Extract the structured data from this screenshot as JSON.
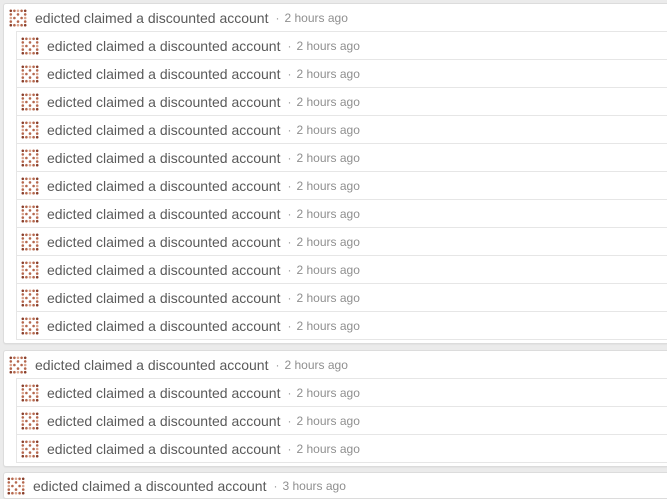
{
  "feed": {
    "separator": "·",
    "groups": [
      {
        "header": {
          "text": "edicted claimed a discounted account",
          "time": "2 hours ago"
        },
        "children": [
          {
            "text": "edicted claimed a discounted account",
            "time": "2 hours ago"
          },
          {
            "text": "edicted claimed a discounted account",
            "time": "2 hours ago"
          },
          {
            "text": "edicted claimed a discounted account",
            "time": "2 hours ago"
          },
          {
            "text": "edicted claimed a discounted account",
            "time": "2 hours ago"
          },
          {
            "text": "edicted claimed a discounted account",
            "time": "2 hours ago"
          },
          {
            "text": "edicted claimed a discounted account",
            "time": "2 hours ago"
          },
          {
            "text": "edicted claimed a discounted account",
            "time": "2 hours ago"
          },
          {
            "text": "edicted claimed a discounted account",
            "time": "2 hours ago"
          },
          {
            "text": "edicted claimed a discounted account",
            "time": "2 hours ago"
          },
          {
            "text": "edicted claimed a discounted account",
            "time": "2 hours ago"
          },
          {
            "text": "edicted claimed a discounted account",
            "time": "2 hours ago"
          }
        ]
      },
      {
        "header": {
          "text": "edicted claimed a discounted account",
          "time": "2 hours ago"
        },
        "children": [
          {
            "text": "edicted claimed a discounted account",
            "time": "2 hours ago"
          },
          {
            "text": "edicted claimed a discounted account",
            "time": "2 hours ago"
          },
          {
            "text": "edicted claimed a discounted account",
            "time": "2 hours ago"
          }
        ]
      },
      {
        "header": {
          "text": "edicted claimed a discounted account",
          "time": "3 hours ago"
        },
        "children": []
      }
    ]
  },
  "avatar": {
    "icon": "identicon-avatar-icon",
    "colors": [
      "#b5674d",
      "#d9a48e",
      "#8a3f2b"
    ]
  }
}
